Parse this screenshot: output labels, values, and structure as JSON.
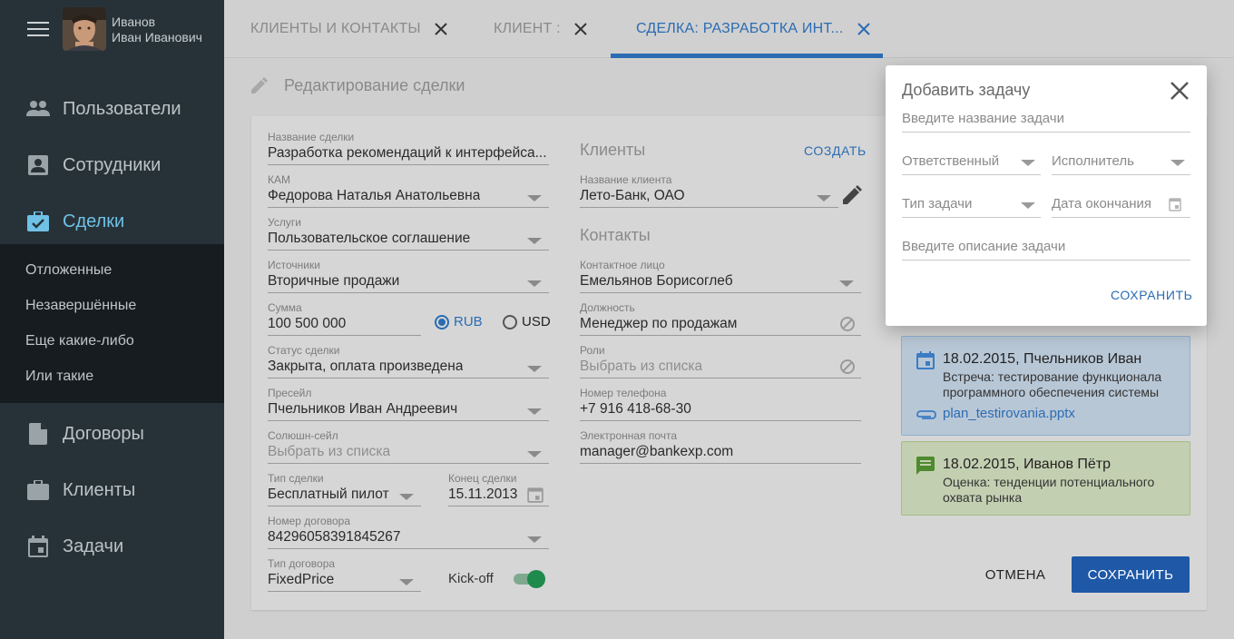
{
  "user": {
    "last_name": "Иванов",
    "first_name": "Иван Иванович"
  },
  "sidebar": {
    "items": [
      {
        "label": "Пользователи",
        "icon": "people-icon"
      },
      {
        "label": "Сотрудники",
        "icon": "badge-icon"
      },
      {
        "label": "Сделки",
        "icon": "briefcase-check-icon",
        "active": true
      },
      {
        "label": "Договоры",
        "icon": "document-icon"
      },
      {
        "label": "Клиенты",
        "icon": "briefcase-icon"
      },
      {
        "label": "Задачи",
        "icon": "calendar-icon"
      }
    ],
    "sub_items": [
      "Отложенные",
      "Незавершённые",
      "Еще какие-либо",
      "Или такие"
    ]
  },
  "tabs": [
    {
      "label": "КЛИЕНТЫ И КОНТАКТЫ"
    },
    {
      "label": "КЛИЕНТ :"
    },
    {
      "label": "СДЕЛКА: РАЗРАБОТКА ИНТ...",
      "active": true
    }
  ],
  "page": {
    "title": "Редактирование сделки"
  },
  "deal": {
    "name": {
      "label": "Название сделки",
      "value": "Разработка рекомендаций к интерфейса..."
    },
    "kam": {
      "label": "КАМ",
      "value": "Федорова Наталья Анатольевна"
    },
    "services": {
      "label": "Услуги",
      "value": "Пользовательское соглашение"
    },
    "sources": {
      "label": "Источники",
      "value": "Вторичные продажи"
    },
    "amount": {
      "label": "Сумма",
      "value": "100 500 000"
    },
    "currency": {
      "options": [
        "RUB",
        "USD"
      ],
      "selected": "RUB"
    },
    "status": {
      "label": "Статус сделки",
      "value": "Закрыта, оплата произведена"
    },
    "presale": {
      "label": "Пресейл",
      "value": "Пчельников Иван Андреевич"
    },
    "solution_sale": {
      "label": "Солюшн-сейл",
      "placeholder": "Выбрать из списка"
    },
    "deal_type": {
      "label": "Тип сделки",
      "value": "Бесплатный пилот"
    },
    "deal_end": {
      "label": "Конец сделки",
      "value": "15.11.2013"
    },
    "contract_number": {
      "label": "Номер договора",
      "value": "84296058391845267"
    },
    "contract_type": {
      "label": "Тип договора",
      "value": "FixedPrice"
    },
    "kickoff": {
      "label": "Kick-off",
      "enabled": true
    }
  },
  "clients": {
    "section_title": "Клиенты",
    "create_label": "СОЗДАТЬ",
    "client_name": {
      "label": "Название клиента",
      "value": "Лето-Банк, ОАО"
    }
  },
  "contacts": {
    "section_title": "Контакты",
    "contact_person": {
      "label": "Контактное лицо",
      "value": "Емельянов Борисоглеб"
    },
    "position": {
      "label": "Должность",
      "value": "Менеджер по продажам"
    },
    "roles": {
      "label": "Роли",
      "placeholder": "Выбрать из списка"
    },
    "phone": {
      "label": "Номер телефона",
      "value": "+7 916 418-68-30"
    },
    "email": {
      "label": "Электронная почта",
      "value": "manager@bankexp.com"
    }
  },
  "activities": [
    {
      "date": "18.02.2015,",
      "person": "Пчельников Иван",
      "text": "Встреча: тестирование функционала программного обеспечения системы",
      "attachment": "plan_testirovania.pptx",
      "color": "#b8c7d6"
    },
    {
      "date": "18.02.2015,",
      "person": "Иванов Пётр",
      "text": "Оценка: тенденции потенциального охвата рынка",
      "color": "#c3cfb1"
    }
  ],
  "actions": {
    "cancel_label": "ОТМЕНА",
    "save_label": "СОХРАНИТЬ"
  },
  "dialog": {
    "title": "Добавить задачу",
    "name_placeholder": "Введите название задачи",
    "responsible_placeholder": "Ответственный",
    "executor_placeholder": "Исполнитель",
    "task_type_placeholder": "Тип задачи",
    "due_date_placeholder": "Дата окончания",
    "description_placeholder": "Введите описание задачи",
    "save_label": "СОХРАНИТЬ"
  },
  "colors": {
    "accent": "#2b6cb3",
    "sidebar": "#273238",
    "sidebar_active": "#6fc1e6",
    "primary_button": "#1e58a6",
    "toggle_on": "#1e8a4c"
  }
}
